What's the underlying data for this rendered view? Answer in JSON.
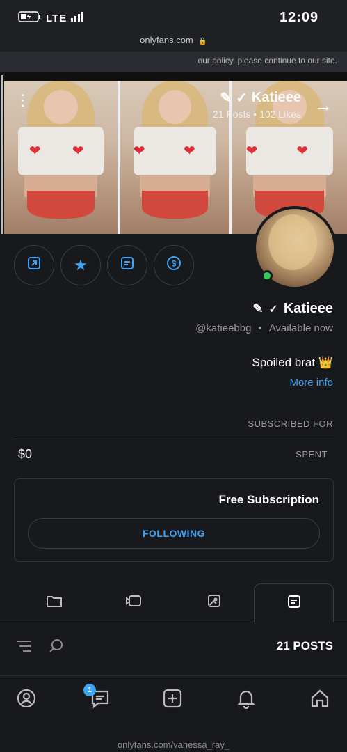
{
  "status": {
    "time": "12:09",
    "network": "LTE"
  },
  "url_bar": {
    "host": "onlyfans.com"
  },
  "banner": {
    "text": "our policy, please continue to our site."
  },
  "cover": {
    "name": "Katieee",
    "stats": "21 Posts • 102 Likes"
  },
  "actions": [
    {
      "icon": "share-icon"
    },
    {
      "icon": "star-icon"
    },
    {
      "icon": "message-icon"
    },
    {
      "icon": "tip-dollar-icon"
    }
  ],
  "profile": {
    "name": "Katieee",
    "handle": "@katieebbg",
    "availability": "Available now",
    "bio": "Spoiled brat 👑",
    "more_info": "More info"
  },
  "subscription": {
    "subscribed_for_label": "SUBSCRIBED FOR",
    "spent_label": "SPENT",
    "spent_value": "$0",
    "title": "Free Subscription",
    "following_label": "FOLLOWING"
  },
  "tabs": [
    {
      "icon": "posts-icon",
      "active": true
    },
    {
      "icon": "photos-icon",
      "active": false
    },
    {
      "icon": "videos-icon",
      "active": false
    },
    {
      "icon": "folder-icon",
      "active": false
    }
  ],
  "posts_header": {
    "count_label": "21 POSTS"
  },
  "bottom_nav": {
    "messages_badge": "1",
    "items": [
      "home-icon",
      "bell-icon",
      "add-icon",
      "messages-icon",
      "profile-icon"
    ]
  },
  "bottom_url": "onlyfans.com/vanessa_ray_",
  "colors": {
    "accent": "#3da3f5",
    "background": "#18191c",
    "online": "#2ecc57"
  }
}
